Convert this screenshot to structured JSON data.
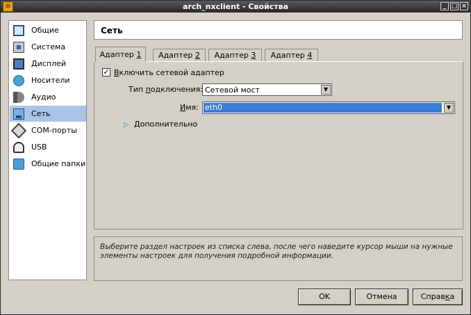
{
  "window": {
    "title": "arch_nxclient - Свойства",
    "icon": "gear-icon",
    "controls": [
      "minimize",
      "maximize",
      "close"
    ]
  },
  "sidebar": {
    "items": [
      {
        "label": "Общие",
        "icon": "general-icon",
        "selected": false
      },
      {
        "label": "Система",
        "icon": "system-icon",
        "selected": false
      },
      {
        "label": "Дисплей",
        "icon": "display-icon",
        "selected": false
      },
      {
        "label": "Носители",
        "icon": "storage-icon",
        "selected": false
      },
      {
        "label": "Аудио",
        "icon": "audio-icon",
        "selected": false
      },
      {
        "label": "Сеть",
        "icon": "network-icon",
        "selected": true
      },
      {
        "label": "COM-порты",
        "icon": "serial-port-icon",
        "selected": false
      },
      {
        "label": "USB",
        "icon": "usb-icon",
        "selected": false
      },
      {
        "label": "Общие папки",
        "icon": "shared-folder-icon",
        "selected": false
      }
    ]
  },
  "section": {
    "title": "Сеть"
  },
  "tabs": [
    {
      "label_pre": "Адаптер ",
      "label_u": "1",
      "active": true
    },
    {
      "label_pre": "Адаптер ",
      "label_u": "2",
      "active": false
    },
    {
      "label_pre": "Адаптер ",
      "label_u": "3",
      "active": false
    },
    {
      "label_pre": "Адаптер ",
      "label_u": "4",
      "active": false
    }
  ],
  "adapter": {
    "enable": {
      "checked": true,
      "label_u": "В",
      "label_rest": "ключить сетевой адаптер"
    },
    "attachment": {
      "label_pre": "Тип ",
      "label_u": "п",
      "label_rest": "одключения:",
      "value": "Сетевой мост"
    },
    "name": {
      "label_u": "И",
      "label_rest": "мя:",
      "value": "eth0"
    },
    "advanced": {
      "label_u": "Д",
      "label_rest": "ополнительно"
    }
  },
  "help": {
    "text": "Выберите раздел настроек из списка слева, после чего наведите курсор мыши на нужные элементы настроек для получения подробной информации."
  },
  "buttons": {
    "ok": "OK",
    "cancel": "Отмена",
    "help_pre": "Справ",
    "help_u": "к",
    "help_rest": "а"
  }
}
